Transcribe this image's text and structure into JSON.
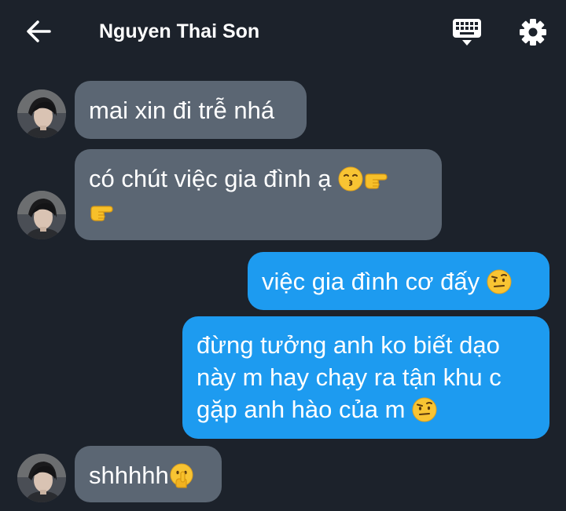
{
  "header": {
    "contact_name": "Nguyen Thai Son",
    "icons": {
      "back": "arrow-left-icon",
      "keyboard": "keyboard-icon",
      "settings": "gear-icon"
    }
  },
  "colors": {
    "background": "#1c222b",
    "incoming_bubble": "#5b6673",
    "outgoing_bubble": "#1d9bf0",
    "text": "#ffffff"
  },
  "messages": [
    {
      "direction": "incoming",
      "text": "mai xin đi trễ nhá"
    },
    {
      "direction": "incoming",
      "text": "có chút việc gia đình ạ",
      "emojis": [
        "kissing-face-icon",
        "pointing-right-icon",
        "pointing-right-icon"
      ]
    },
    {
      "direction": "outgoing",
      "text": "việc gia đình cơ đấy",
      "emojis": [
        "raised-eyebrow-face-icon"
      ]
    },
    {
      "direction": "outgoing",
      "lines": [
        "đừng tưởng anh ko biết dạo",
        "này m hay chạy ra tận khu c",
        "gặp anh hào của m"
      ],
      "emojis": [
        "raised-eyebrow-face-icon"
      ]
    },
    {
      "direction": "incoming",
      "text": "shhhhh",
      "emojis": [
        "shushing-face-icon"
      ]
    }
  ]
}
